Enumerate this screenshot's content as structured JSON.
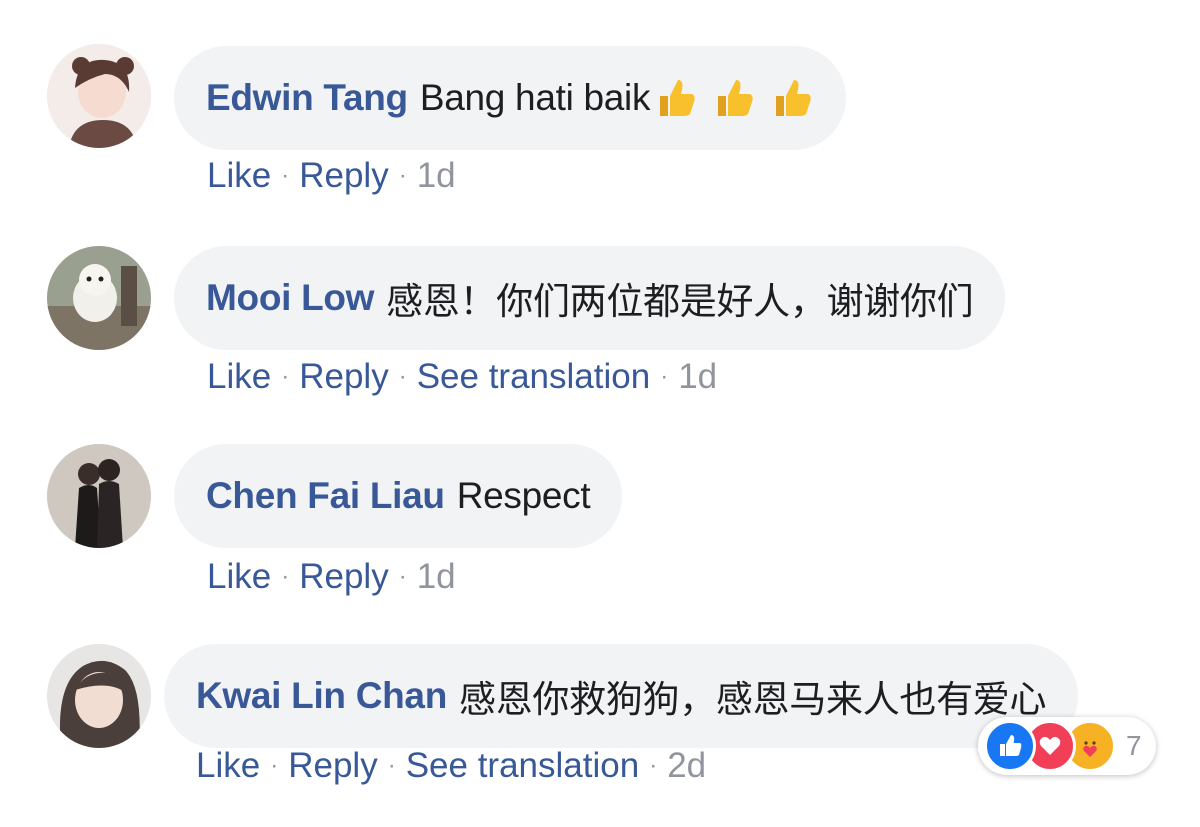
{
  "actions": {
    "like": "Like",
    "reply": "Reply",
    "see_translation": "See translation",
    "separator": "·"
  },
  "colors": {
    "author": "#385898",
    "bubble": "#f2f3f5",
    "meta": "#90949c",
    "like_blue": "#1877f2",
    "love_red": "#f33e58",
    "care_yellow": "#f7b125"
  },
  "comments": [
    {
      "author": "Edwin Tang",
      "text": "Bang hati baik",
      "emoji_icons": [
        "thumbs-up-icon",
        "thumbs-up-icon",
        "thumbs-up-icon"
      ],
      "time": "1d"
    },
    {
      "author": "Mooi Low",
      "text": "感恩！你们两位都是好人，谢谢你们",
      "time": "1d"
    },
    {
      "author": "Chen Fai Liau",
      "text": "Respect",
      "time": "1d"
    },
    {
      "author": "Kwai Lin Chan",
      "text": "感恩你救狗狗，感恩马来人也有爱心",
      "time": "2d",
      "reactions": {
        "icons": [
          "like-reaction-icon",
          "love-reaction-icon",
          "care-reaction-icon"
        ],
        "count": "7"
      }
    }
  ]
}
